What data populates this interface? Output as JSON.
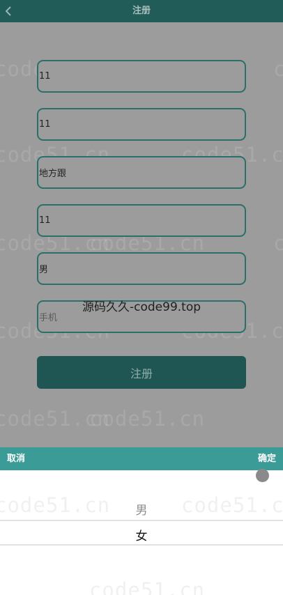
{
  "header": {
    "title": "注册",
    "back_icon": "chevron-left-icon"
  },
  "form": {
    "fields": [
      {
        "value": "11",
        "placeholder": ""
      },
      {
        "value": "11",
        "placeholder": ""
      },
      {
        "value": "地方跟",
        "placeholder": ""
      },
      {
        "value": "11",
        "placeholder": ""
      },
      {
        "value": "男",
        "placeholder": ""
      },
      {
        "value": "",
        "placeholder": "手机"
      }
    ],
    "submit_label": "注册"
  },
  "watermark": {
    "text": "code51.cn",
    "center_text": "源码久久-code99.top"
  },
  "picker": {
    "cancel_label": "取消",
    "confirm_label": "确定",
    "options": [
      "男",
      "女"
    ],
    "selected": "女"
  }
}
